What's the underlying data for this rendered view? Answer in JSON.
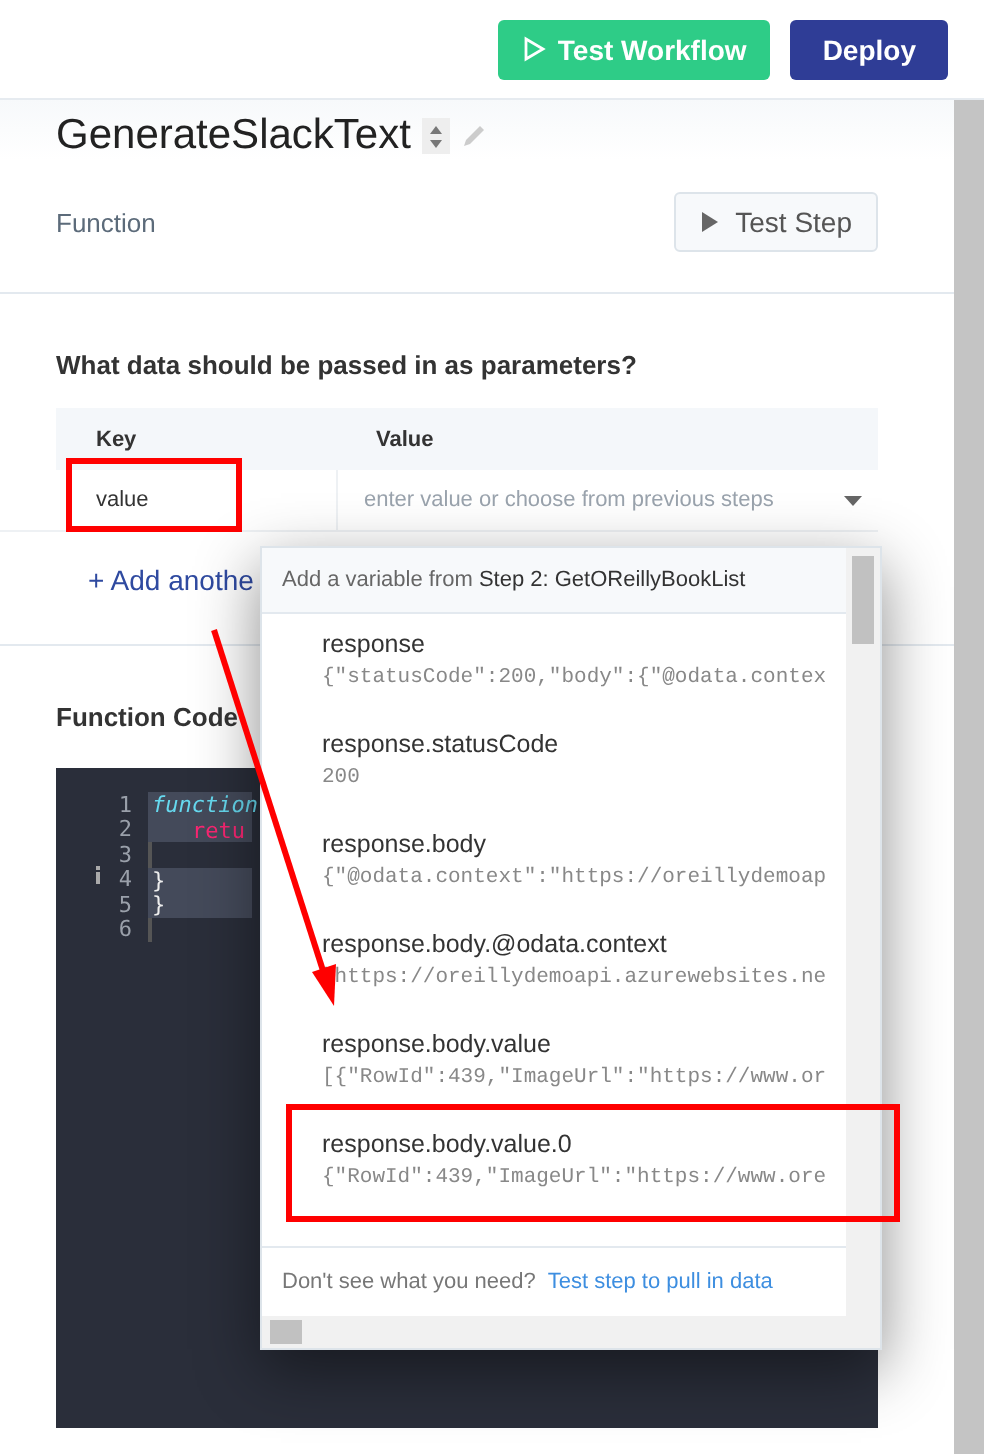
{
  "toolbar": {
    "buttons": [
      {
        "kind": "run",
        "label": "Test Workflow"
      },
      {
        "kind": "primary",
        "label": "Deploy"
      }
    ]
  },
  "step": {
    "title": "GenerateSlackText",
    "type": "Function",
    "test_button": "Test Step"
  },
  "params": {
    "question": "What data should be passed in as parameters?",
    "columns": [
      "Key",
      "Value"
    ],
    "rows": [
      {
        "key": "value",
        "placeholder": "enter value or choose from previous steps",
        "highlighted": true
      }
    ],
    "add_link": "+ Add anothe"
  },
  "code": {
    "title": "Function Code",
    "lines": [
      {
        "number": "1",
        "text": "function",
        "kind": "keyword"
      },
      {
        "number": "2",
        "text": "retu",
        "kind": "return"
      },
      {
        "number": "3"
      },
      {
        "number": "4",
        "text": "}",
        "kind": "plain",
        "marker": true
      },
      {
        "number": "5",
        "text": "}",
        "kind": "plain"
      },
      {
        "number": "6"
      }
    ]
  },
  "dropdown": {
    "header": "Add a variable from **Step 2: GetOReillyBookList**",
    "items": [
      {
        "name": "response",
        "value": "{\"statusCode\":200,\"body\":{\"@odata.contex",
        "highlighted": false
      },
      {
        "name": "response.statusCode",
        "value": "200",
        "highlighted": false
      },
      {
        "name": "response.body",
        "value": "{\"@odata.context\":\"https://oreillydemoap",
        "highlighted": false
      },
      {
        "name": "response.body.@odata.context",
        "value": "\"https://oreillydemoapi.azurewebsites.ne",
        "highlighted": false
      },
      {
        "name": "response.body.value",
        "value": "[{\"RowId\":439,\"ImageUrl\":\"https://www.or",
        "highlighted": false
      },
      {
        "name": "response.body.value.0",
        "value": "{\"RowId\":439,\"ImageUrl\":\"https://www.ore",
        "highlighted": true
      }
    ],
    "footer_text": "Don't see what you need?",
    "footer_link": "Test step to pull in data"
  }
}
